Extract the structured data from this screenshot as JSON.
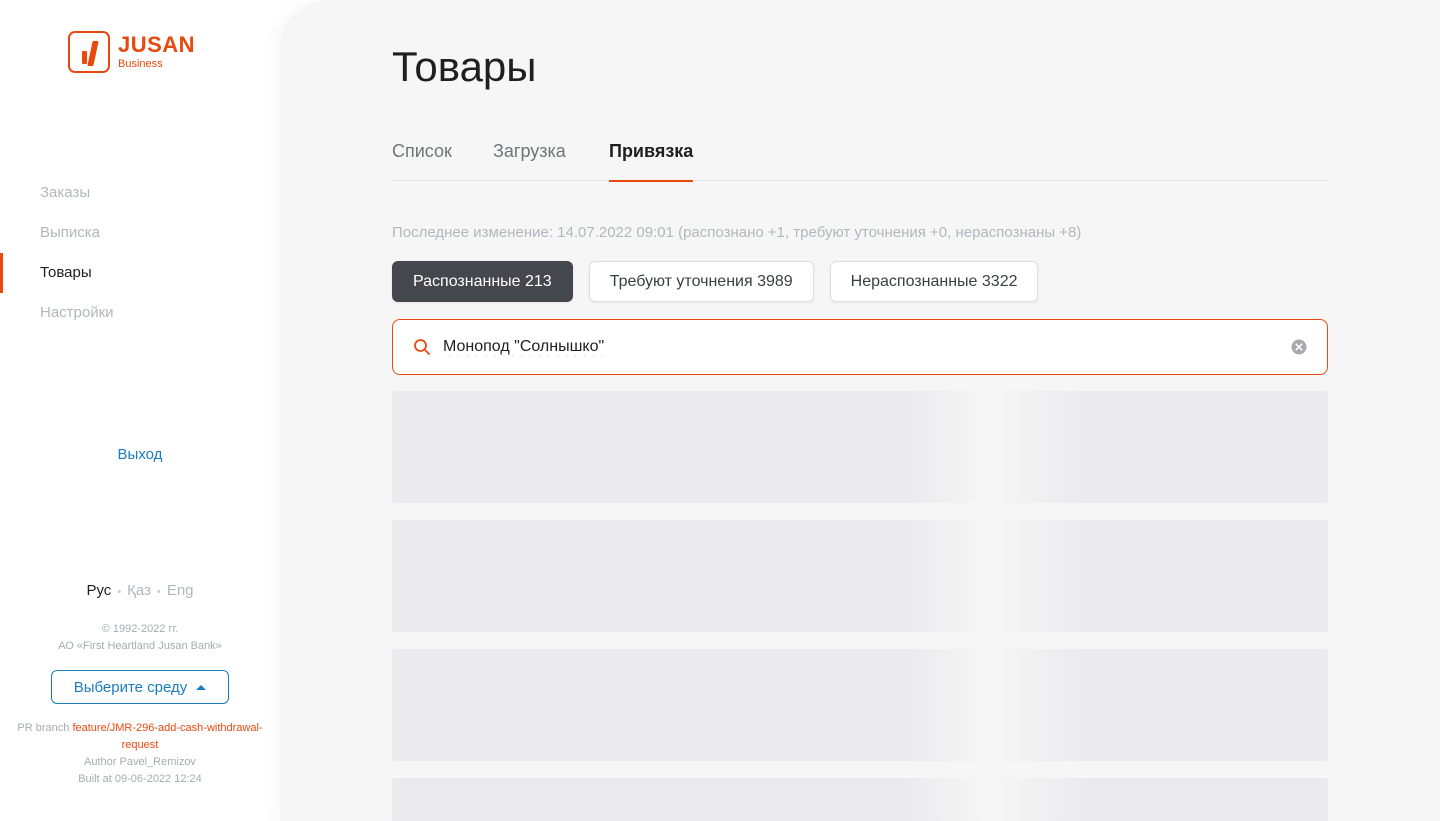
{
  "brand": {
    "name": "JUSAN",
    "sub": "Business",
    "color": "#e8490f"
  },
  "sidebar": {
    "items": [
      {
        "label": "Заказы",
        "active": false
      },
      {
        "label": "Выписка",
        "active": false
      },
      {
        "label": "Товары",
        "active": true
      },
      {
        "label": "Настройки",
        "active": false
      }
    ],
    "logout": "Выход",
    "languages": [
      {
        "label": "Рус",
        "active": true
      },
      {
        "label": "Қаз",
        "active": false
      },
      {
        "label": "Eng",
        "active": false
      }
    ],
    "copyright_line1": "© 1992-2022 гг.",
    "copyright_line2": "АО «First Heartland Jusan Bank»",
    "env_button": "Выберите среду",
    "build": {
      "pr_label": "PR branch",
      "branch": "feature/JMR-296-add-cash-withdrawal-request",
      "author": "Author Pavel_Remizov",
      "built": "Built at 09-06-2022 12:24"
    }
  },
  "main": {
    "title": "Товары",
    "tabs": [
      {
        "label": "Список",
        "active": false
      },
      {
        "label": "Загрузка",
        "active": false
      },
      {
        "label": "Привязка",
        "active": true
      }
    ],
    "last_change": "Последнее изменение: 14.07.2022 09:01 (распознано +1, требуют уточнения +0, нераспознаны +8)",
    "filters": [
      {
        "label": "Распознанные 213",
        "active": true
      },
      {
        "label": "Требуют уточнения 3989",
        "active": false
      },
      {
        "label": "Нераспознанные 3322",
        "active": false
      }
    ],
    "search": {
      "value": "Монопод \"Солнышко\"",
      "icon": "search-icon",
      "clear_icon": "clear-icon"
    },
    "skeleton_rows": 4
  }
}
